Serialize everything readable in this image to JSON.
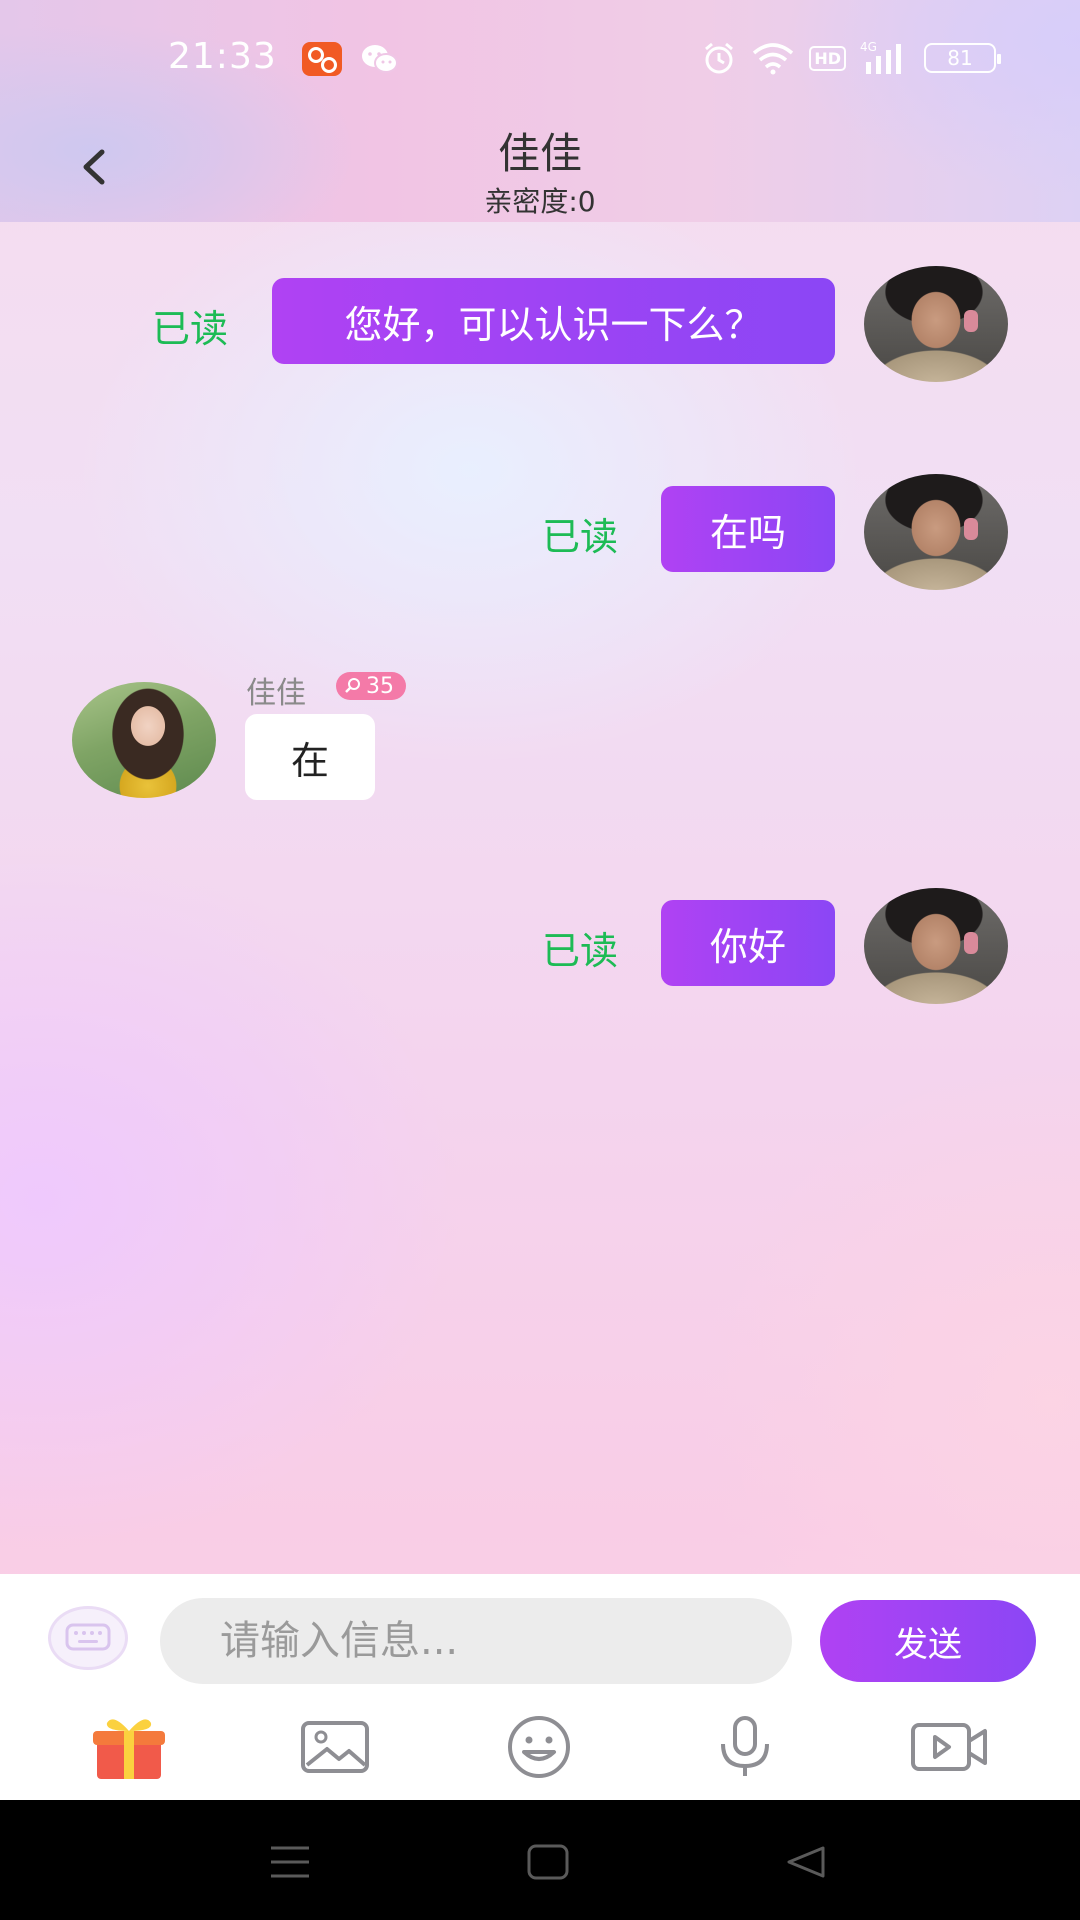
{
  "status_bar": {
    "time": "21:33",
    "battery": "81",
    "hd_label": "HD",
    "network_label": "4G",
    "icons": [
      "kuaishou-app-icon",
      "wechat-icon",
      "alarm-icon",
      "wifi-icon",
      "hd-icon",
      "signal-4g-icon",
      "battery-icon"
    ]
  },
  "header": {
    "back_icon": "chevron-left-icon",
    "title": "佳佳",
    "intimacy": "亲密度:0"
  },
  "colors": {
    "accent_gradient_start": "#b042f3",
    "accent_gradient_end": "#8b46f5",
    "read_status": "#1dbb55",
    "intimacy_badge": "#f47aa8"
  },
  "messages": [
    {
      "direction": "out",
      "text": "您好，可以认识一下么？",
      "status": "已读"
    },
    {
      "direction": "out",
      "text": "在吗",
      "status": "已读"
    },
    {
      "direction": "in",
      "sender": "佳佳",
      "badge": "35",
      "badge_icon": "search-heart-icon",
      "text": "在"
    },
    {
      "direction": "out",
      "text": "你好",
      "status": "已读"
    }
  ],
  "composer": {
    "placeholder": "请输入信息...",
    "send_label": "发送",
    "keyboard_icon": "keyboard-icon"
  },
  "toolbar": {
    "icons": [
      "gift-icon",
      "image-icon",
      "emoji-icon",
      "microphone-icon",
      "video-call-icon"
    ]
  },
  "system_nav": {
    "icons": [
      "menu-icon",
      "home-icon",
      "back-triangle-icon"
    ]
  }
}
